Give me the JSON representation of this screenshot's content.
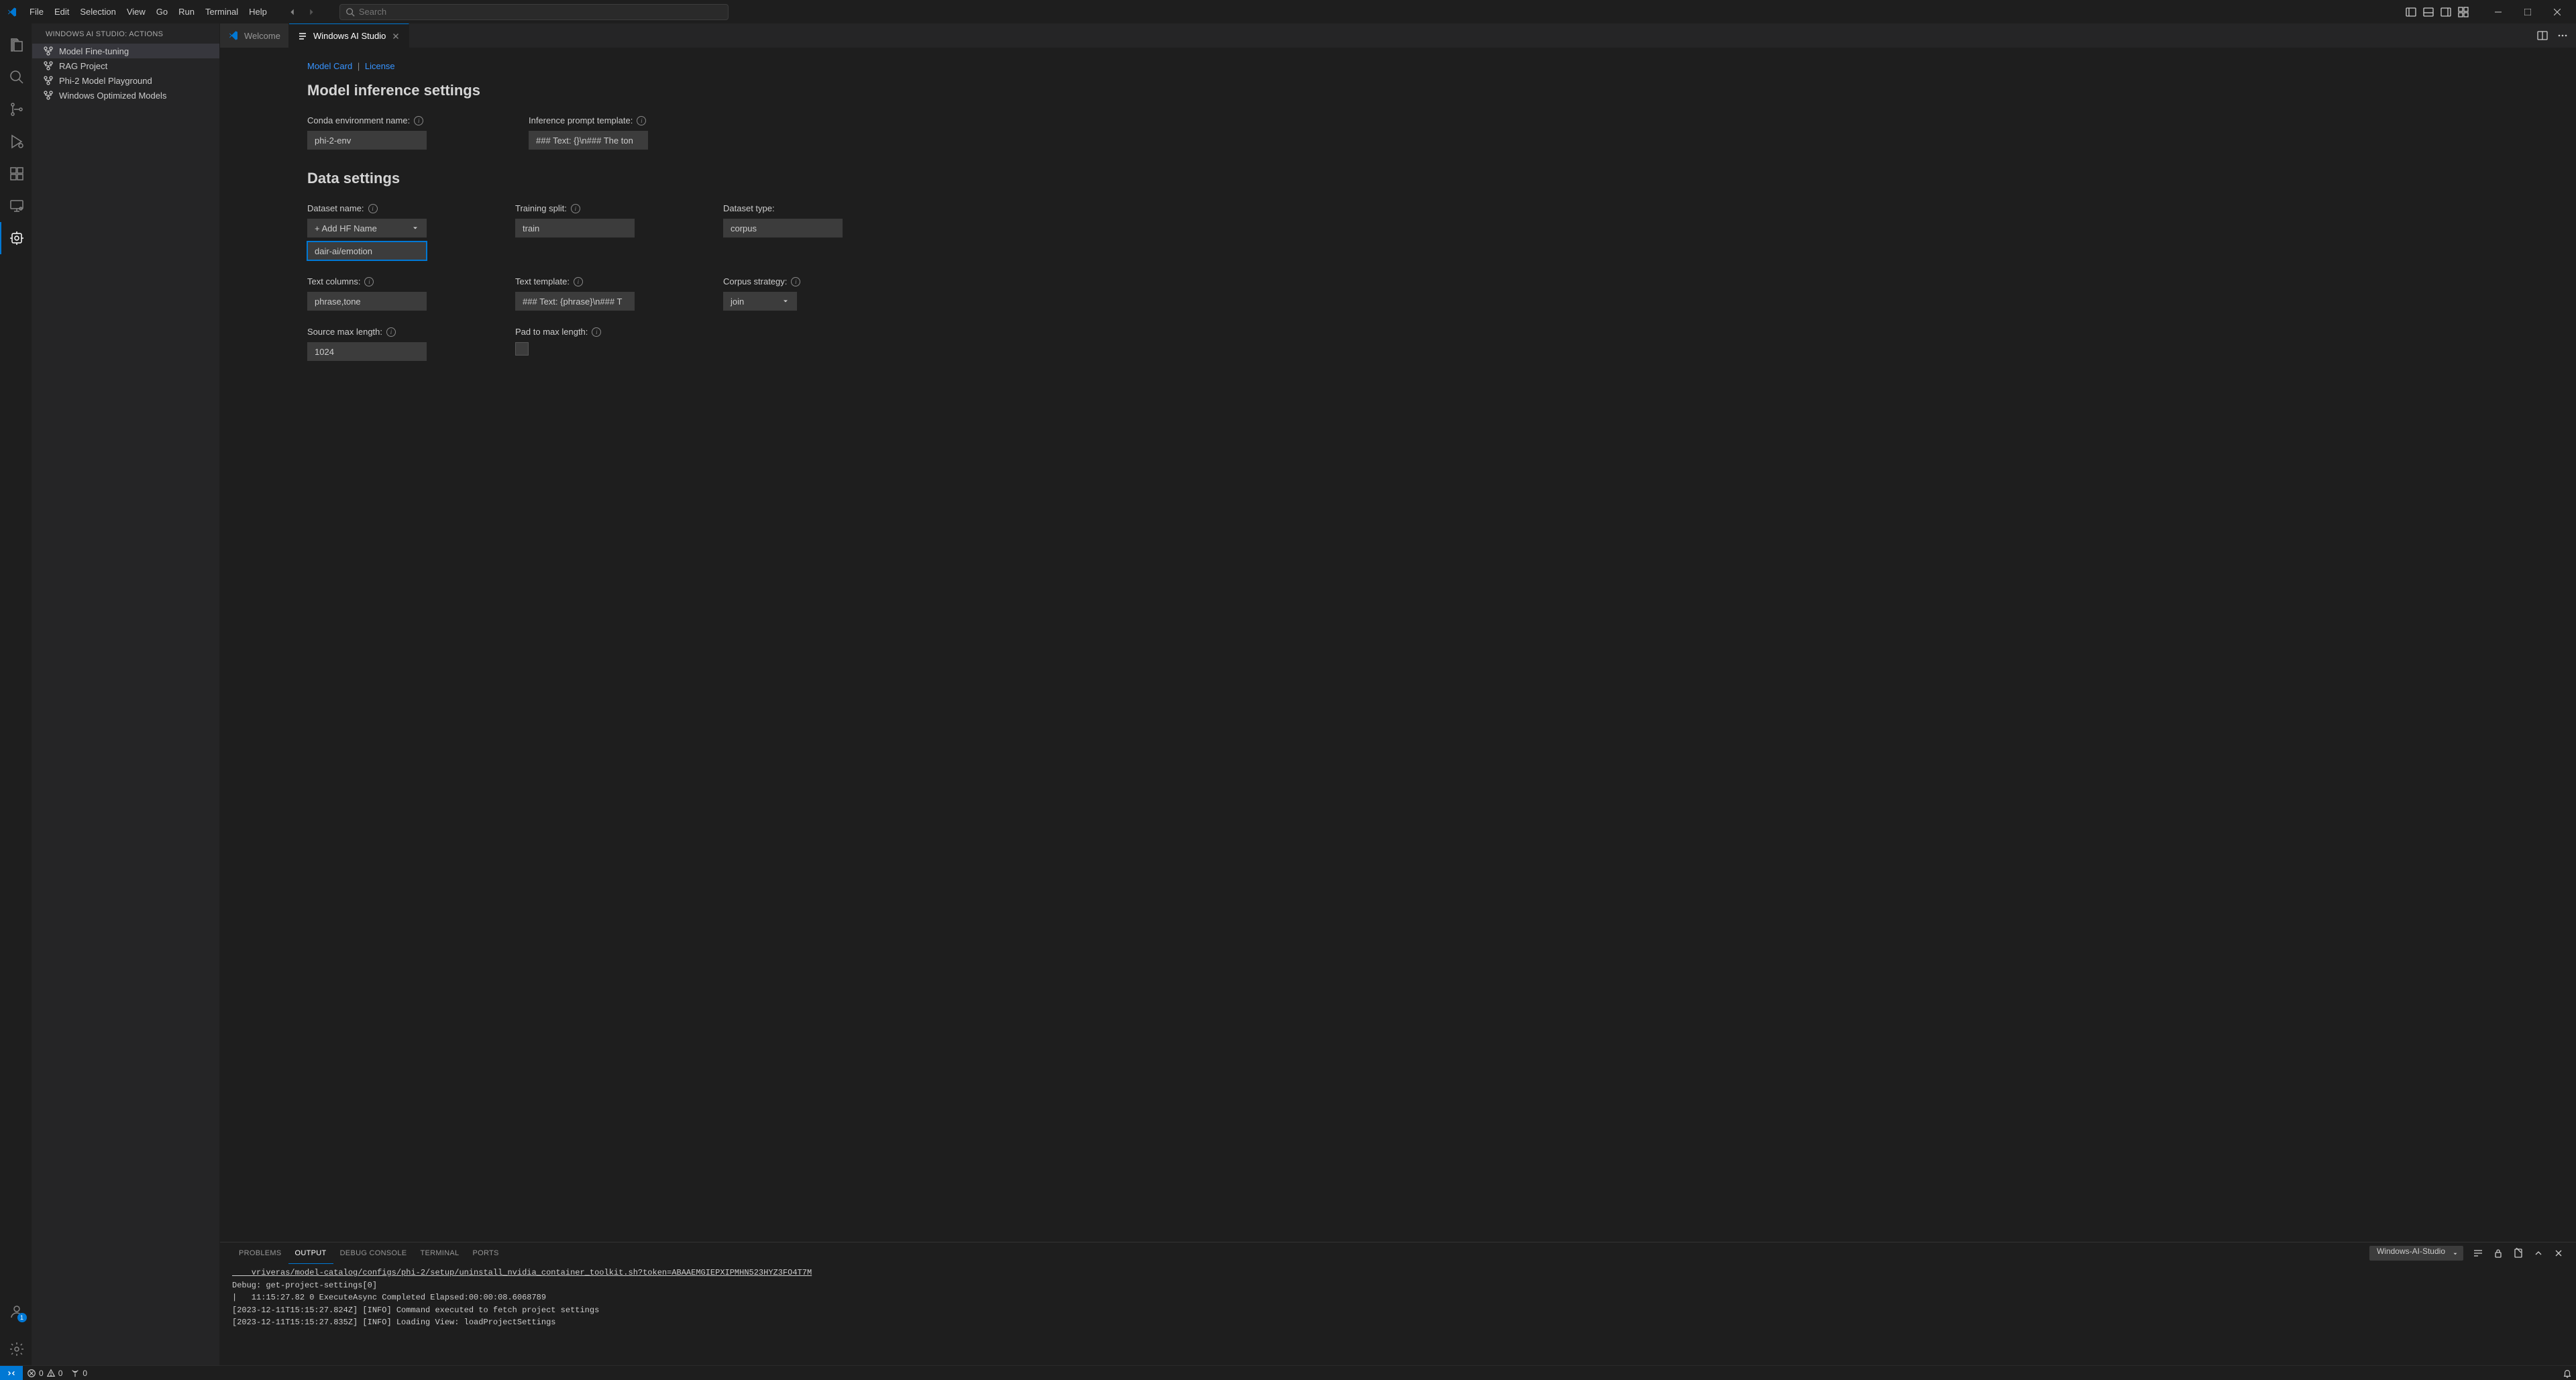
{
  "menubar": [
    "File",
    "Edit",
    "Selection",
    "View",
    "Go",
    "Run",
    "Terminal",
    "Help"
  ],
  "search_placeholder": "Search",
  "sidebar": {
    "title": "WINDOWS AI STUDIO: ACTIONS",
    "items": [
      "Model Fine-tuning",
      "RAG Project",
      "Phi-2 Model Playground",
      "Windows Optimized Models"
    ],
    "selected_index": 0
  },
  "tabs": [
    {
      "label": "Welcome",
      "active": false
    },
    {
      "label": "Windows AI Studio",
      "active": true
    }
  ],
  "content": {
    "links": {
      "model_card": "Model Card",
      "sep": "|",
      "license": "License"
    },
    "section_inference": "Model inference settings",
    "section_data": "Data settings",
    "conda_env": {
      "label": "Conda environment name:",
      "value": "phi-2-env"
    },
    "prompt_template": {
      "label": "Inference prompt template:",
      "value": "### Text: {}\\n### The ton"
    },
    "dataset_name": {
      "label": "Dataset name:",
      "placeholder": "+ Add HF Name",
      "value": "dair-ai/emotion"
    },
    "training_split": {
      "label": "Training split:",
      "value": "train"
    },
    "dataset_type": {
      "label": "Dataset type:",
      "value": "corpus"
    },
    "text_columns": {
      "label": "Text columns:",
      "value": "phrase,tone"
    },
    "text_template": {
      "label": "Text template:",
      "value": "### Text: {phrase}\\n### T"
    },
    "corpus_strategy": {
      "label": "Corpus strategy:",
      "value": "join"
    },
    "source_max_len": {
      "label": "Source max length:",
      "value": "1024"
    },
    "pad_max_len": {
      "label": "Pad to max length:"
    }
  },
  "panel": {
    "tabs": [
      "PROBLEMS",
      "OUTPUT",
      "DEBUG CONSOLE",
      "TERMINAL",
      "PORTS"
    ],
    "active_tab": "OUTPUT",
    "output_channel": "Windows-AI-Studio",
    "lines": [
      "    vriveras/model-catalog/configs/phi-2/setup/uninstall_nvidia_container_toolkit.sh?token=ABAAEMGIEPXIPMHN523HYZ3FO4T7M",
      "Debug: get-project-settings[0]",
      "|   11:15:27.82 0 ExecuteAsync Completed Elapsed:00:00:08.6068789",
      "[2023-12-11T15:15:27.824Z] [INFO] Command executed to fetch project settings",
      "[2023-12-11T15:15:27.835Z] [INFO] Loading View: loadProjectSettings"
    ]
  },
  "statusbar": {
    "errors": "0",
    "warnings": "0",
    "ports": "0"
  }
}
